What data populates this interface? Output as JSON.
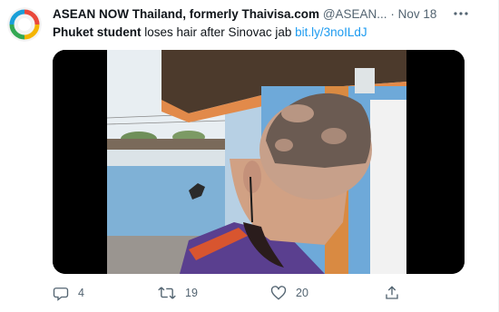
{
  "tweet": {
    "author_name": "ASEAN NOW Thailand, formerly Thaivisa.com",
    "handle": "@ASEAN...",
    "separator": "·",
    "date": "Nov 18",
    "text_bold": "Phuket student",
    "text_rest": " loses hair after Sinovac jab ",
    "link": "bit.ly/3noILdJ"
  },
  "actions": {
    "replies": "4",
    "retweets": "19",
    "likes": "20"
  },
  "colors": {
    "link": "#1d9bf0",
    "muted": "#536471",
    "avatar_ring": [
      "#e9483b",
      "#f4b400",
      "#34a853",
      "#1a9fd8"
    ]
  },
  "icons": [
    "asean-now-logo",
    "more-options-icon",
    "reply-icon",
    "retweet-icon",
    "like-icon",
    "share-icon"
  ]
}
